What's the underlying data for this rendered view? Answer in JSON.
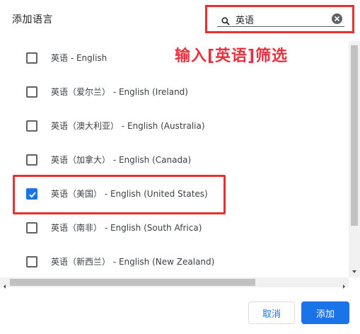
{
  "dialog": {
    "title": "添加语言",
    "search": {
      "value": "英语",
      "placeholder": ""
    },
    "annotation": "输入[英语]筛选",
    "languages": [
      {
        "label": "英语 - English",
        "checked": false
      },
      {
        "label": "英语（爱尔兰） - English (Ireland)",
        "checked": false
      },
      {
        "label": "英语（澳大利亚） - English (Australia)",
        "checked": false
      },
      {
        "label": "英语（加拿大） - English (Canada)",
        "checked": false
      },
      {
        "label": "英语（美国） - English (United States)",
        "checked": true
      },
      {
        "label": "英语（南非） - English (South Africa)",
        "checked": false
      },
      {
        "label": "英语（新西兰） - English (New Zealand)",
        "checked": false
      }
    ],
    "buttons": {
      "cancel": "取消",
      "add": "添加"
    }
  },
  "colors": {
    "accent": "#1a73e8",
    "annotation_red": "#e8302e"
  },
  "icons": {
    "search": "search-icon",
    "clear": "clear-icon",
    "check": "checkmark-icon"
  }
}
